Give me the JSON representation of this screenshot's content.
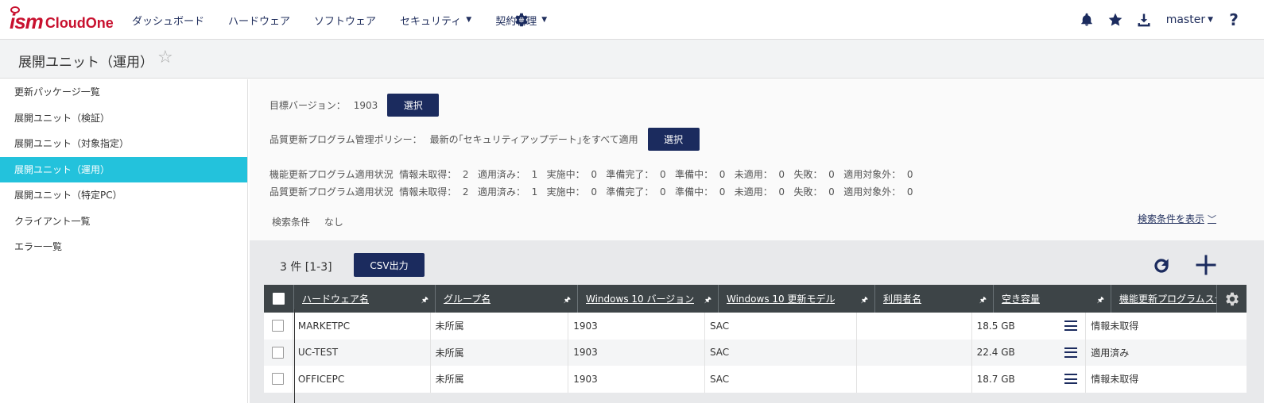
{
  "header": {
    "logo_ism": "ism",
    "logo_cloud": "CloudOne",
    "nav": [
      {
        "label": "ダッシュボード",
        "dropdown": false
      },
      {
        "label": "ハードウェア",
        "dropdown": false
      },
      {
        "label": "ソフトウェア",
        "dropdown": false
      },
      {
        "label": "セキュリティ",
        "dropdown": true
      },
      {
        "label": "契約管理",
        "dropdown": true
      }
    ],
    "user": "master",
    "help": "?"
  },
  "title": {
    "text": "展開ユニット（運用）",
    "star": "☆"
  },
  "sidebar": {
    "items": [
      {
        "label": "更新パッケージ一覧",
        "active": false
      },
      {
        "label": "展開ユニット（検証）",
        "active": false
      },
      {
        "label": "展開ユニット（対象指定）",
        "active": false
      },
      {
        "label": "展開ユニット（運用）",
        "active": true
      },
      {
        "label": "展開ユニット（特定PC）",
        "active": false
      },
      {
        "label": "クライアント一覧",
        "active": false
      },
      {
        "label": "エラー一覧",
        "active": false
      }
    ]
  },
  "info": {
    "target_label": "目標バージョン：",
    "target_value": "1903",
    "select_label": "選択",
    "policy_label": "品質更新プログラム管理ポリシー：",
    "policy_value": "最新の｢セキュリティアップデート｣をすべて適用",
    "feature_status": "機能更新プログラム適用状況  情報未取得：  2   適用済み：  1   実施中：  0   準備完了：  0   準備中：  0   未適用：  0   失敗：  0   適用対象外：  0",
    "quality_status": "品質更新プログラム適用状況  情報未取得：  2   適用済み：  1   実施中：  0   準備完了：  0   準備中：  0   未適用：  0   失敗：  0   適用対象外：  0",
    "cond_label": "検索条件",
    "cond_value": "なし",
    "show_cond": "検索条件を表示"
  },
  "list": {
    "count": "3 件  [1-3]",
    "csv_label": "CSV出力"
  },
  "table": {
    "columns": [
      "ハードウェア名",
      "グループ名",
      "Windows 10 バージョン",
      "Windows 10 更新モデル",
      "利用者名",
      "空き容量",
      "機能更新プログラムステータス"
    ],
    "rows": [
      [
        "MARKETPC",
        "未所属",
        "1903",
        "SAC",
        "",
        "18.5 GB",
        "情報未取得"
      ],
      [
        "UC-TEST",
        "未所属",
        "1903",
        "SAC",
        "",
        "22.4 GB",
        "適用済み"
      ],
      [
        "OFFICEPC",
        "未所属",
        "1903",
        "SAC",
        "",
        "18.7 GB",
        "情報未取得"
      ]
    ]
  },
  "colors": {
    "navy": "#1b2b5e",
    "active_cyan": "#23c2dc",
    "header_dark": "#3d4447",
    "logo_red": "#c8102e"
  },
  "icons": [
    "gear-icon",
    "bell-icon",
    "star-icon",
    "download-icon",
    "refresh-icon",
    "plus-icon",
    "pin-icon",
    "menu-icon"
  ]
}
